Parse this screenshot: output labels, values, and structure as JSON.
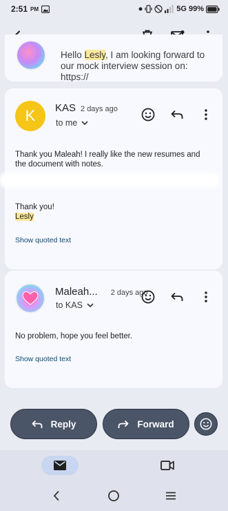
{
  "status_bar": {
    "time": "2:51",
    "ampm": "PM",
    "network": "5G",
    "battery": "99%"
  },
  "app_bar": {
    "back_icon": "arrow-left-icon",
    "delete_icon": "trash-icon",
    "unread_icon": "mark-unread-icon",
    "more_icon": "more-vert-icon"
  },
  "previous_message": {
    "line1_before": "Hello ",
    "line1_highlight": "Lesly",
    "line1_after": ", I am looking forward to",
    "line2": "our mock interview session on: https://"
  },
  "message_kas": {
    "avatar_letter": "K",
    "avatar_color": "#f5c518",
    "sender": "KAS",
    "time": "2 days ago",
    "recipient": "to me",
    "body": "Thank you Maleah! I really like the new resumes and the document with notes.",
    "signoff": "Thank you!",
    "signature": "Lesly",
    "show_quoted": "Show quoted text"
  },
  "message_maleah": {
    "sender": "Maleah...",
    "time": "2 days ago",
    "recipient": "to KAS",
    "body": "No problem, hope you feel better.",
    "show_quoted": "Show quoted text"
  },
  "actions": {
    "reply_label": "Reply",
    "forward_label": "Forward"
  },
  "bottom_nav": {
    "mail_icon": "mail-icon",
    "meet_icon": "video-icon"
  },
  "colors": {
    "background": "#e9ebf3",
    "card": "#f8f9ff",
    "pill": "#4a5568",
    "highlight": "#fbe99a",
    "link": "#0b4a6f"
  }
}
